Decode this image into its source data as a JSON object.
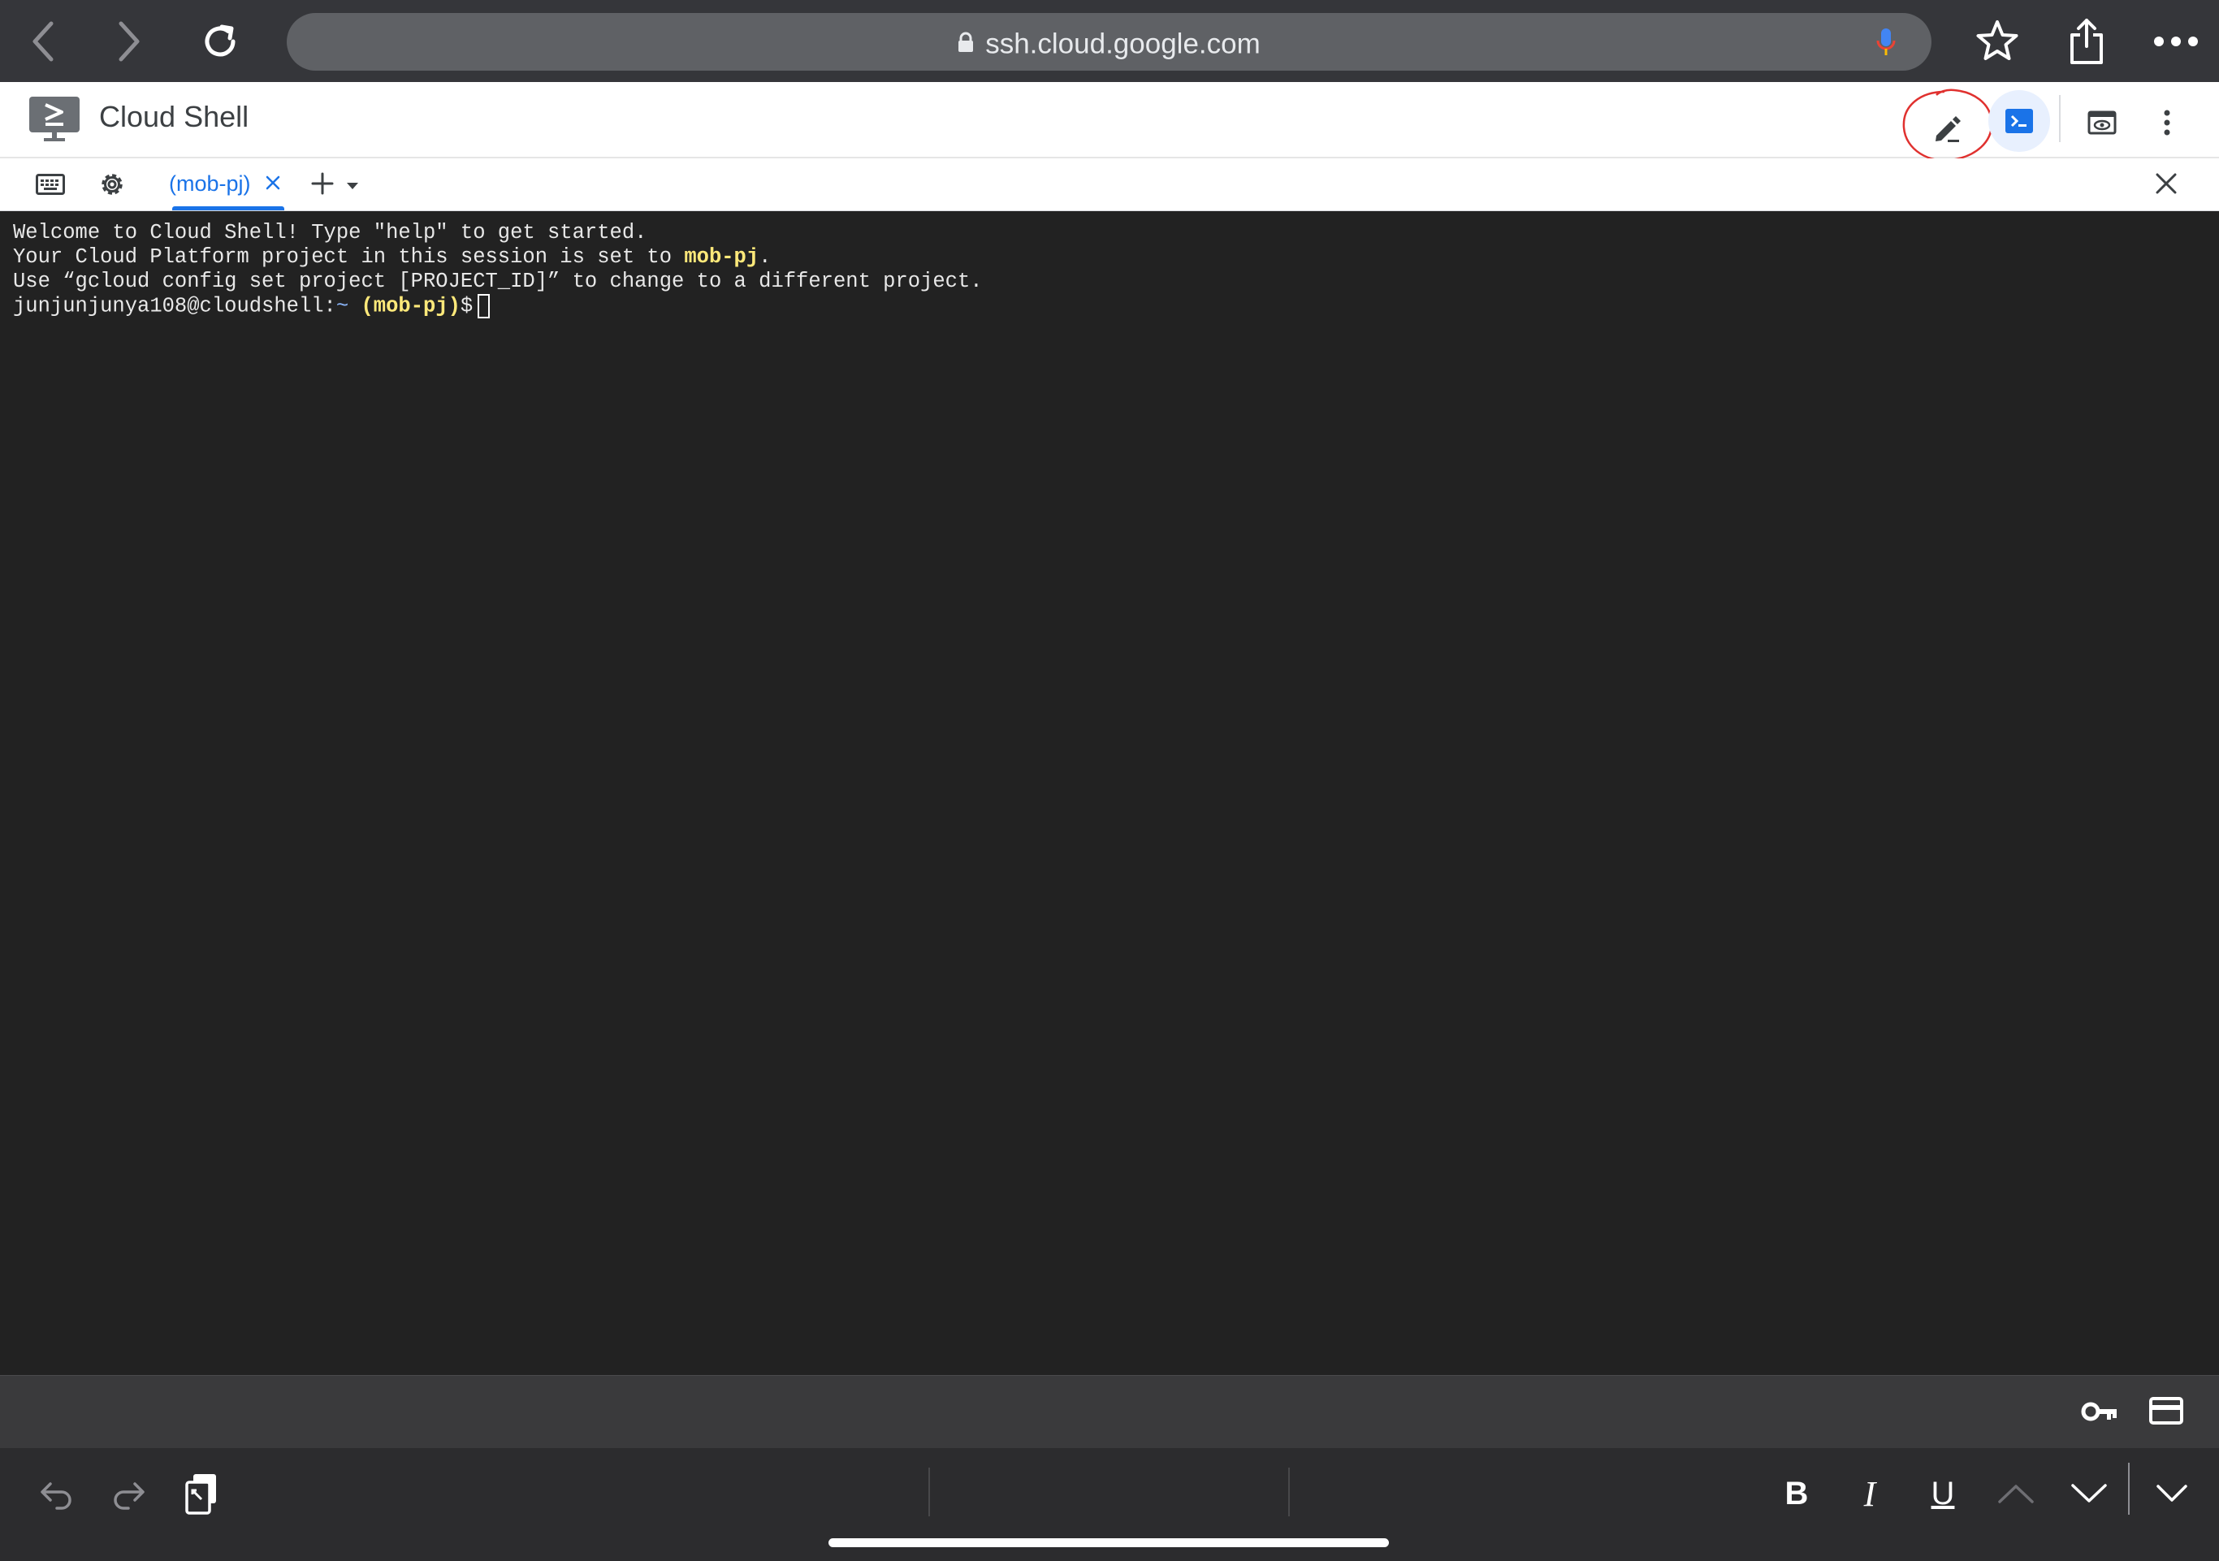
{
  "browser": {
    "url": "ssh.cloud.google.com"
  },
  "header": {
    "title": "Cloud Shell",
    "accent": "#1a73e8"
  },
  "tabs": {
    "active_label": "(mob-pj)"
  },
  "terminal": {
    "line1": "Welcome to Cloud Shell! Type \"help\" to get started.",
    "line2_prefix": "Your Cloud Platform project in this session is set to ",
    "line2_project": "mob-pj",
    "line2_suffix": ".",
    "line3": "Use “gcloud config set project [PROJECT_ID]” to change to a different project.",
    "prompt_user": "junjunjunya108@cloudshell:",
    "prompt_dir": "~",
    "prompt_project": "(mob-pj)",
    "prompt_symbol": "$"
  },
  "keyboard_toolbar": {
    "bold": "B",
    "italic": "I",
    "underline": "U"
  }
}
